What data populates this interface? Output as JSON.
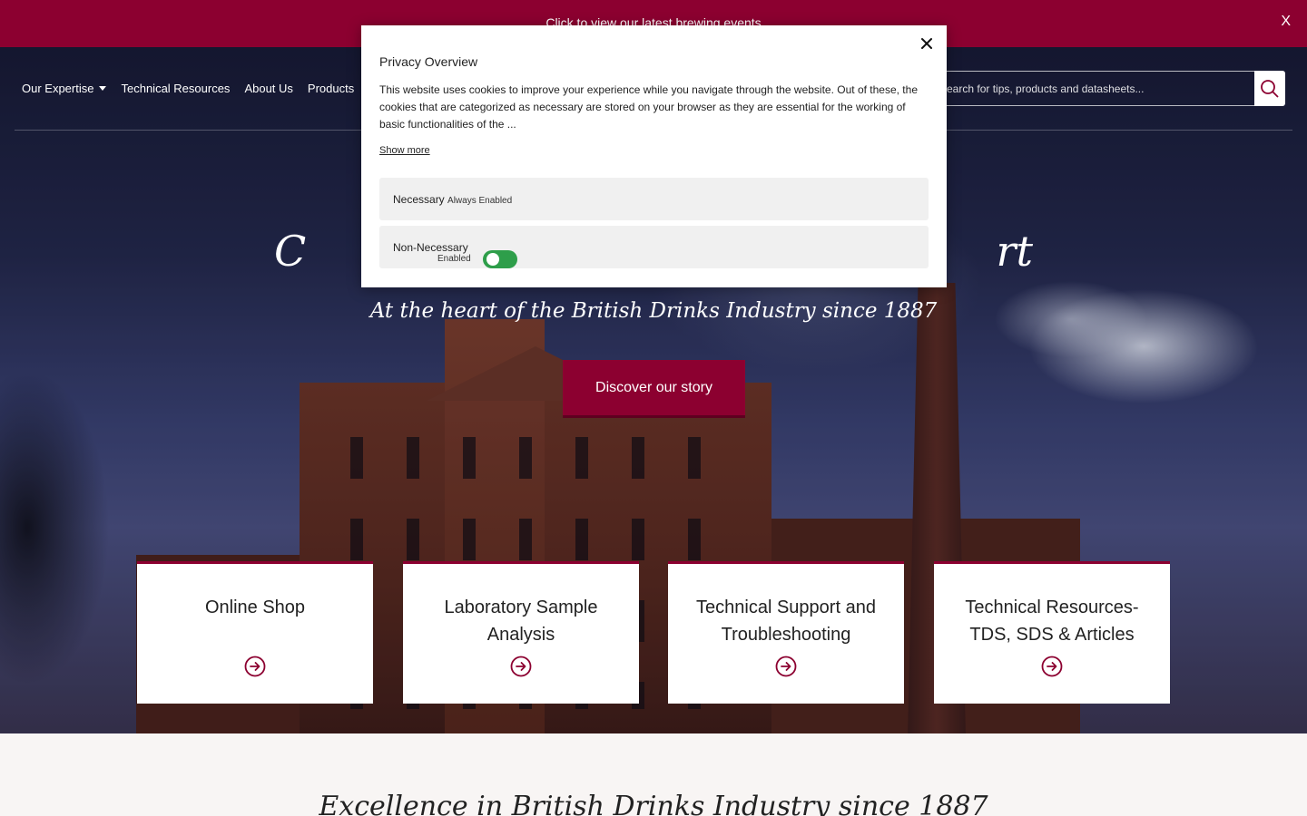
{
  "announcement": {
    "text": "Click to view our latest brewing events",
    "close_label": "X"
  },
  "nav": {
    "items": [
      {
        "label": "Our Expertise",
        "has_dropdown": true
      },
      {
        "label": "Technical Resources",
        "has_dropdown": false
      },
      {
        "label": "About Us",
        "has_dropdown": false
      },
      {
        "label": "Products",
        "has_dropdown": false
      }
    ]
  },
  "search": {
    "placeholder": "Search for tips, products and datasheets...",
    "value": "",
    "icon": "search-icon"
  },
  "hero": {
    "title": "C                                                    rt",
    "subtitle": "At the heart of the British Drinks Industry since 1887",
    "cta_label": "Discover our story"
  },
  "cards": [
    {
      "title": "Online Shop",
      "icon": "arrow-right-circle-icon"
    },
    {
      "title": "Laboratory Sample Analysis",
      "icon": "arrow-right-circle-icon"
    },
    {
      "title": "Technical Support and Troubleshooting",
      "icon": "arrow-right-circle-icon"
    },
    {
      "title": "Technical Resources- TDS, SDS & Articles",
      "icon": "arrow-right-circle-icon"
    }
  ],
  "section": {
    "title": "Excellence in British Drinks Industry since 1887"
  },
  "cookie_modal": {
    "title": "Privacy Overview",
    "description": "This website uses cookies to improve your experience while you navigate through the website. Out of these, the cookies that are categorized as necessary are stored on your browser as they are essential for the working of basic functionalities of the ...",
    "show_more": "Show more",
    "rows": [
      {
        "label": "Necessary",
        "status": "Always Enabled"
      },
      {
        "label": "Non-Necessary",
        "status": "Enabled",
        "toggle_on": true
      }
    ]
  },
  "colors": {
    "brand": "#8c0030",
    "toggle_on": "#2e9e4a",
    "card_bg": "#ffffff"
  }
}
